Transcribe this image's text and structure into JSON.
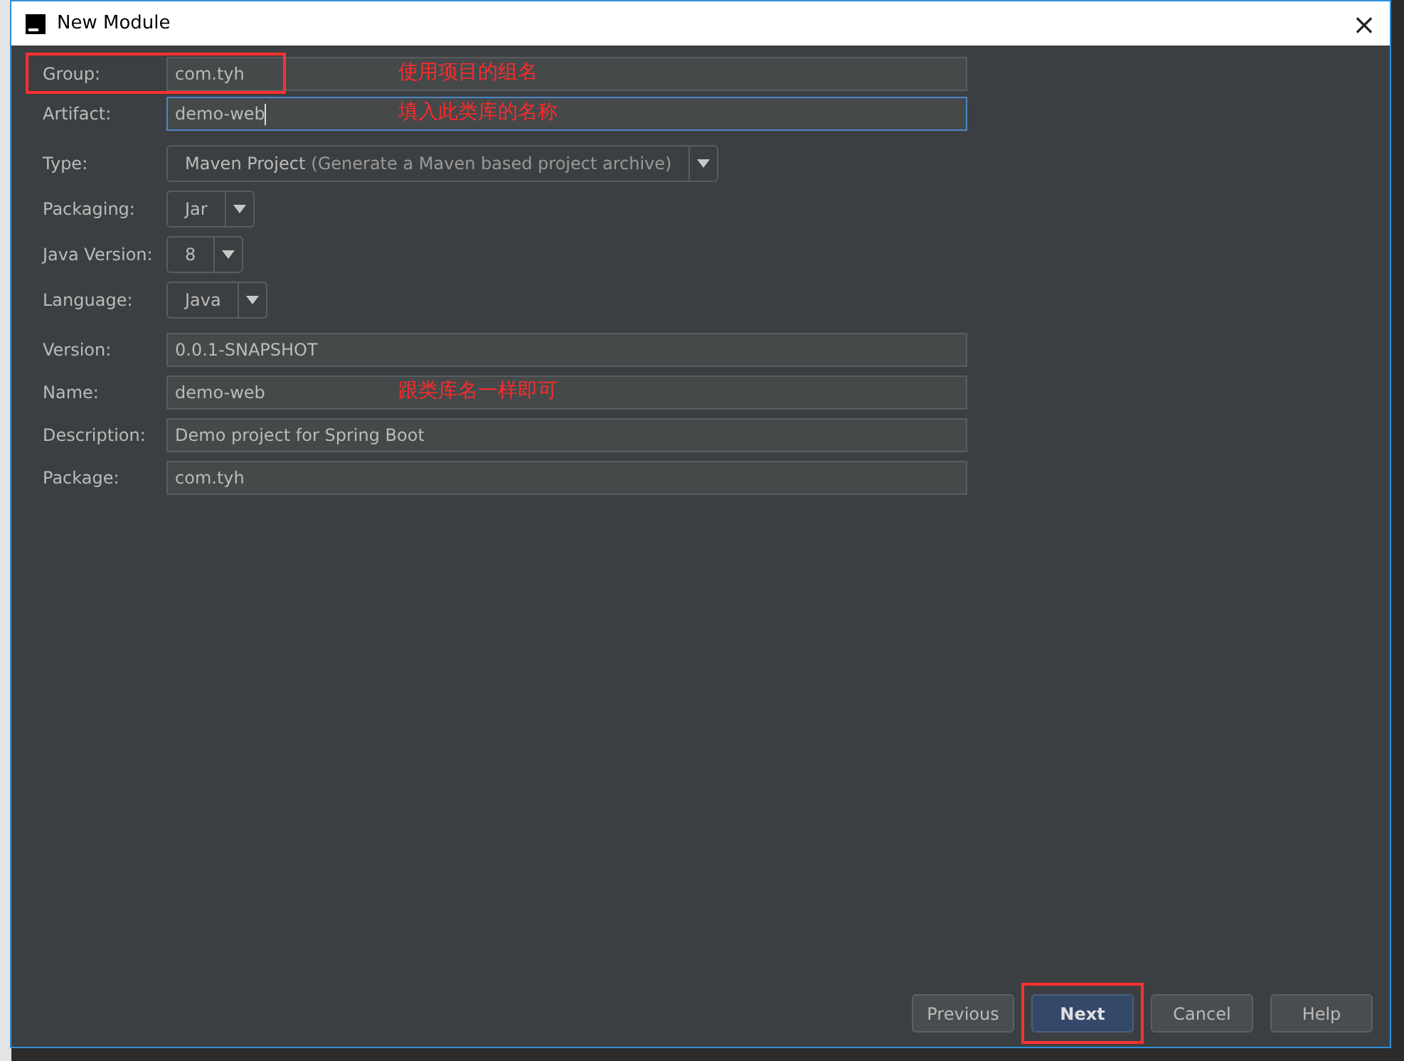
{
  "window": {
    "title": "New Module",
    "close": "×"
  },
  "sections": [
    {
      "rows": [
        {
          "label": "Group:",
          "kind": "text",
          "value": "com.tyh",
          "focused": false,
          "highlighted": true,
          "note": "使用项目的组名"
        },
        {
          "label": "Artifact:",
          "kind": "text",
          "value": "demo-web",
          "focused": true,
          "highlighted": false,
          "note": "填入此类库的名称"
        }
      ]
    },
    {
      "rows": [
        {
          "label": "Type:",
          "kind": "dropdown",
          "value": "Maven Project",
          "hint": "(Generate a Maven based project archive)"
        },
        {
          "label": "Packaging:",
          "kind": "dropdown",
          "value": "Jar"
        },
        {
          "label": "Java Version:",
          "kind": "dropdown",
          "value": "8"
        },
        {
          "label": "Language:",
          "kind": "dropdown",
          "value": "Java"
        }
      ]
    },
    {
      "rows": [
        {
          "label": "Version:",
          "kind": "text",
          "value": "0.0.1-SNAPSHOT",
          "focused": false,
          "highlighted": false
        },
        {
          "label": "Name:",
          "kind": "text",
          "value": "demo-web",
          "focused": false,
          "highlighted": false,
          "note": "跟类库名一样即可"
        },
        {
          "label": "Description:",
          "kind": "text",
          "value": "Demo project for Spring Boot",
          "focused": false,
          "highlighted": false
        },
        {
          "label": "Package:",
          "kind": "text",
          "value": "com.tyh",
          "focused": false,
          "highlighted": false
        }
      ]
    }
  ],
  "buttons": [
    {
      "label": "Previous",
      "kind": "normal",
      "highlighted": false
    },
    {
      "label": "Next",
      "kind": "default",
      "highlighted": true
    },
    {
      "label": "Cancel",
      "kind": "normal",
      "highlighted": false
    },
    {
      "label": "Help",
      "kind": "normal",
      "highlighted": false
    }
  ]
}
